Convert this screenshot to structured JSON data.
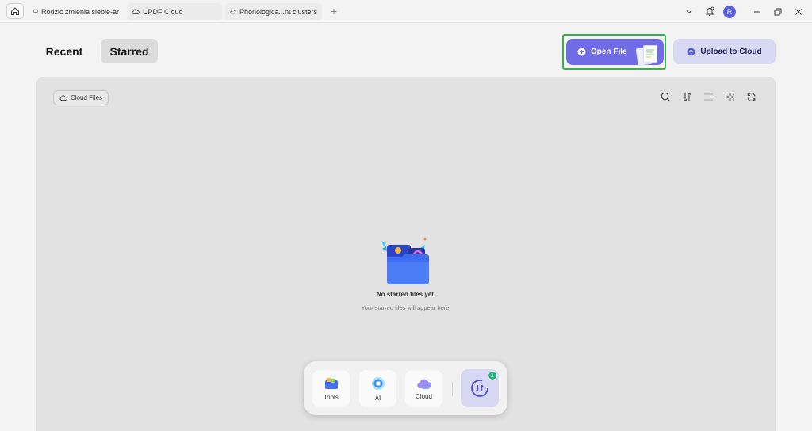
{
  "tabs": [
    {
      "label": "Rodzic zmienia siebie-ar",
      "icon": "presentation-icon"
    },
    {
      "label": "UPDF Cloud",
      "icon": "cloud-icon"
    },
    {
      "label": "Phonologica...nt clusters",
      "icon": "cloud-icon"
    }
  ],
  "titlebar": {
    "avatar_letter": "R"
  },
  "header": {
    "recent_label": "Recent",
    "starred_label": "Starred",
    "open_file_label": "Open File",
    "upload_label": "Upload to Cloud"
  },
  "panel": {
    "cloud_files_label": "Cloud Files",
    "empty_title": "No starred files yet.",
    "empty_subtitle": "Your starred files will appear here."
  },
  "dock": {
    "tools_label": "Tools",
    "ai_label": "AI",
    "cloud_label": "Cloud",
    "sync_badge": "1"
  },
  "colors": {
    "accent": "#6f6ce6",
    "upload_bg": "#d8d9f3",
    "highlight_border": "#35b24a",
    "badge": "#22b07d"
  }
}
